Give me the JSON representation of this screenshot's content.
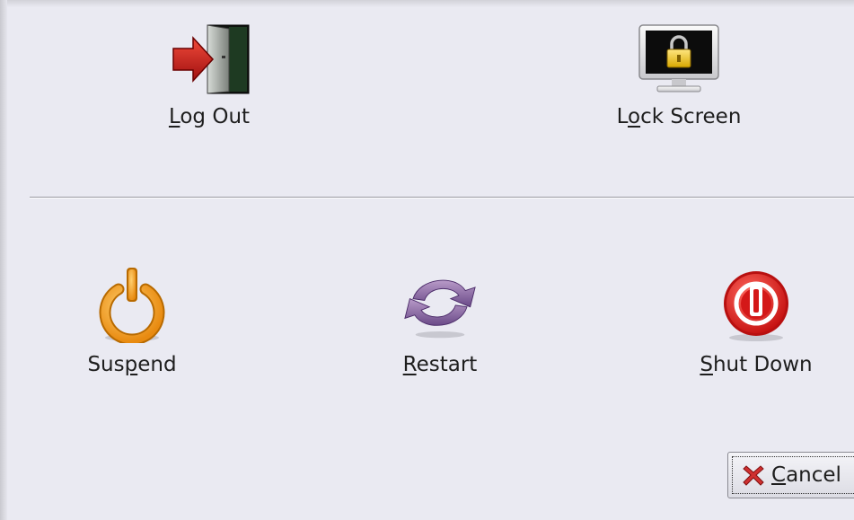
{
  "dialog": {
    "actions": {
      "logout": {
        "label": "Log Out",
        "mnemonic_index": 0,
        "icon": "logout-door-icon"
      },
      "lock": {
        "label": "Lock Screen",
        "mnemonic_index": 1,
        "icon": "lock-monitor-icon"
      },
      "suspend": {
        "label": "Suspend",
        "mnemonic_index": 3,
        "icon": "suspend-power-icon"
      },
      "restart": {
        "label": "Restart",
        "mnemonic_index": 0,
        "icon": "restart-arrows-icon"
      },
      "shutdown": {
        "label": "Shut Down",
        "mnemonic_index": 0,
        "icon": "shutdown-power-icon"
      }
    },
    "cancel": {
      "label": "Cancel",
      "mnemonic_index": 0,
      "icon": "cancel-x-icon"
    },
    "colors": {
      "background": "#eaeaf2",
      "suspend": "#f0a020",
      "restart": "#8a6aa0",
      "shutdown": "#d42020",
      "cancel_x": "#d03030"
    }
  }
}
